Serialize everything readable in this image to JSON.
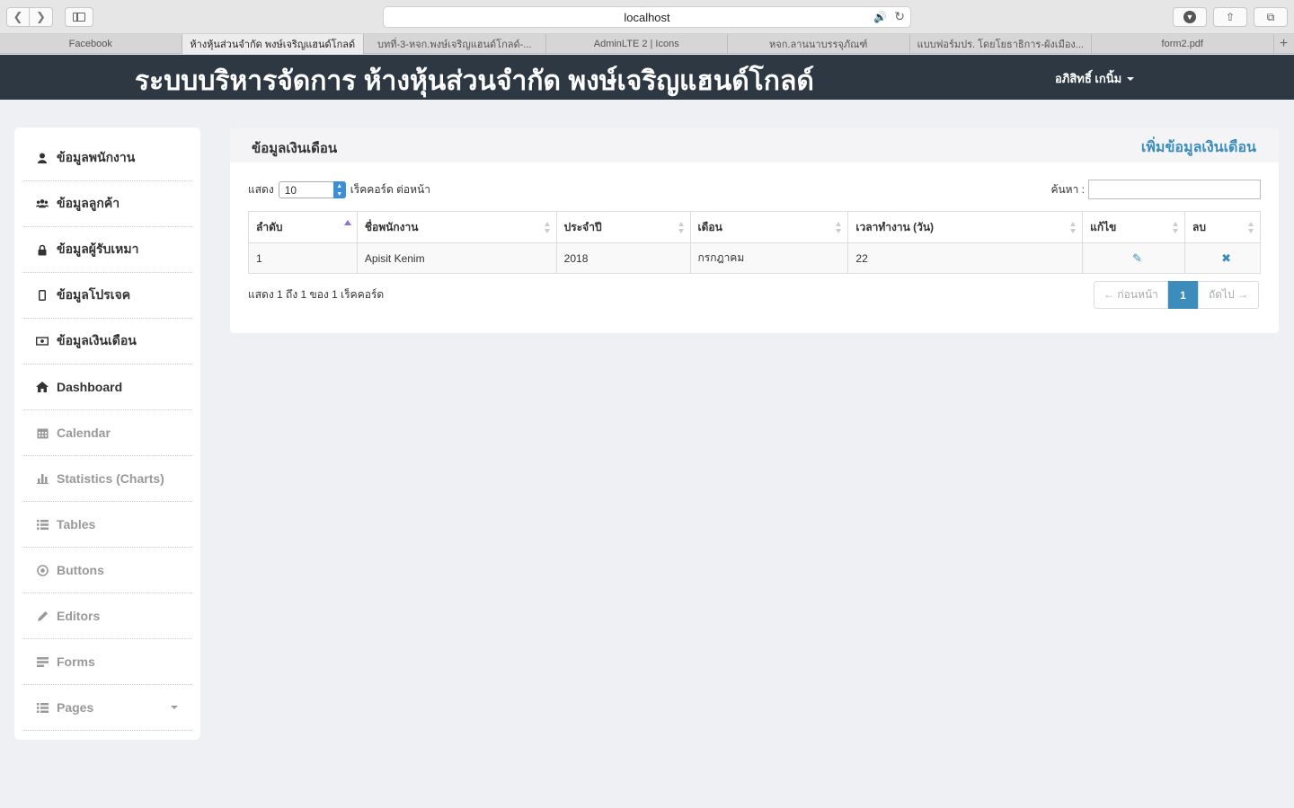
{
  "browser": {
    "url": "localhost",
    "tabs": [
      {
        "title": "Facebook"
      },
      {
        "title": "ห้างหุ้นส่วนจำกัด พงษ์เจริญแฮนด์โกลด์"
      },
      {
        "title": "บทที่-3-หจก.พงษ์เจริญแฮนด์โกลด์-..."
      },
      {
        "title": "AdminLTE 2 | Icons"
      },
      {
        "title": "หจก.ลานนาบรรจุภัณฑ์"
      },
      {
        "title": "แบบฟอร์มปร. โดยโยธาธิการ-ผังเมือง..."
      },
      {
        "title": "form2.pdf"
      }
    ]
  },
  "header": {
    "title": "ระบบบริหารจัดการ ห้างหุ้นส่วนจำกัด พงษ์เจริญแฮนด์โกลด์",
    "user": "อภิสิทธิ์ เกนิ้ม"
  },
  "sidebar": {
    "items": [
      {
        "label": "ข้อมูลพนักงาน",
        "icon": "user-icon"
      },
      {
        "label": "ข้อมูลลูกค้า",
        "icon": "users-icon"
      },
      {
        "label": "ข้อมูลผู้รับเหมา",
        "icon": "lock-icon"
      },
      {
        "label": "ข้อมูลโปรเจค",
        "icon": "mobile-icon"
      },
      {
        "label": "ข้อมูลเงินเดือน",
        "icon": "money-icon"
      },
      {
        "label": "Dashboard",
        "icon": "home-icon"
      },
      {
        "label": "Calendar",
        "icon": "calendar-icon"
      },
      {
        "label": "Statistics (Charts)",
        "icon": "bar-chart-icon"
      },
      {
        "label": "Tables",
        "icon": "list-icon"
      },
      {
        "label": "Buttons",
        "icon": "dot-circle-icon"
      },
      {
        "label": "Editors",
        "icon": "pencil-icon"
      },
      {
        "label": "Forms",
        "icon": "form-icon"
      },
      {
        "label": "Pages",
        "icon": "list-icon"
      }
    ]
  },
  "main": {
    "title": "ข้อมูลเงินเดือน",
    "add_link": "เพิ่มข้อมูลเงินเดือน",
    "length": {
      "prefix": "แสดง",
      "value": "10",
      "suffix": "เร็คคอร์ด ต่อหน้า"
    },
    "search_label": "ค้นหา :",
    "columns": [
      "ลำดับ",
      "ชื่อพนักงาน",
      "ประจำปี",
      "เดือน",
      "เวลาทำงาน (วัน)",
      "แก้ไข",
      "ลบ"
    ],
    "rows": [
      {
        "no": "1",
        "name": "Apisit Kenim",
        "year": "2018",
        "month": "กรกฎาคม",
        "days": "22"
      }
    ],
    "info": "แสดง 1 ถึง 1 ของ 1 เร็คคอร์ด",
    "pagination": {
      "prev": "← ก่อนหน้า",
      "current": "1",
      "next": "ถัดไป →"
    }
  },
  "colors": {
    "header_bg": "#2d3843",
    "accent": "#3c8dbc",
    "page_bg": "#eef0f3"
  }
}
